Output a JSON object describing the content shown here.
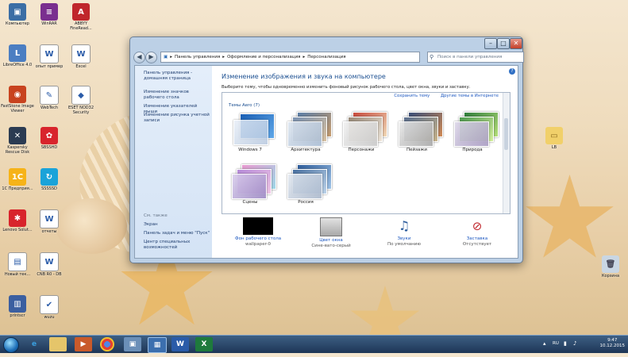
{
  "desktop": {
    "icons": [
      {
        "label": "Компьютер",
        "color": "#3b6ea5",
        "glyph": "▣",
        "icon": "computer-icon"
      },
      {
        "label": "WinRAR",
        "color": "#7a2f8f",
        "glyph": "≡",
        "icon": "winrar-icon"
      },
      {
        "label": "ABBYY FineRead...",
        "color": "#c0262c",
        "glyph": "A",
        "icon": "abbyy-icon"
      },
      {
        "label": "LibreOffice 4.0",
        "color": "#4b7ec2",
        "glyph": "L",
        "icon": "libreoffice-icon"
      },
      {
        "label": "опыт пример",
        "color": "#ffffff",
        "glyph": "W",
        "icon": "word-document-icon"
      },
      {
        "label": "Excel",
        "color": "#ffffff",
        "glyph": "W",
        "icon": "word-document-icon"
      },
      {
        "label": "FastStone Image Viewer",
        "color": "#c8431f",
        "glyph": "◉",
        "icon": "faststone-icon"
      },
      {
        "label": "WebTech",
        "color": "#ffffff",
        "glyph": "✎",
        "icon": "webtech-icon"
      },
      {
        "label": "ESET NOD32 Security",
        "color": "#ffffff",
        "glyph": "◆",
        "icon": "eset-icon"
      },
      {
        "label": "Kaspersky Rescue Disk",
        "color": "#2b3b52",
        "glyph": "✕",
        "icon": "rescue-disk-icon"
      },
      {
        "label": "SBSSHD",
        "color": "#d8242c",
        "glyph": "✿",
        "icon": "sbsshd-icon"
      },
      {
        "label": "1С Предприя...",
        "color": "#f6b318",
        "glyph": "1С",
        "icon": "1c-icon"
      },
      {
        "label": "SSSSSD",
        "color": "#1aa3d9",
        "glyph": "↻",
        "icon": "sync-icon"
      },
      {
        "label": "Lenovo Solut...",
        "color": "#d8242c",
        "glyph": "✱",
        "icon": "lenovo-icon"
      },
      {
        "label": "отчеты",
        "color": "#ffffff",
        "glyph": "W",
        "icon": "word-document-icon"
      },
      {
        "label": "Новый тек...",
        "color": "#ffffff",
        "glyph": "▤",
        "icon": "pdf-document-icon"
      },
      {
        "label": "CNB R0 - DB",
        "color": "#ffffff",
        "glyph": "W",
        "icon": "word-document-icon"
      },
      {
        "label": "printscr",
        "color": "#3b5fa0",
        "glyph": "▥",
        "icon": "printscreen-icon"
      },
      {
        "label": "wuzu",
        "color": "#ffffff",
        "glyph": "✔",
        "icon": "checklist-icon"
      }
    ],
    "folder_label": "LB",
    "recycle_label": "Корзина"
  },
  "window": {
    "buttons": {
      "minimize": "–",
      "maximize": "□",
      "close": "✕"
    },
    "nav": {
      "back": "◀",
      "forward": "▶"
    },
    "breadcrumb": [
      "Панель управления",
      "Оформление и персонализация",
      "Персонализация"
    ],
    "search_placeholder": "Поиск в панели управления",
    "left_links": [
      "Панель управления - домашняя страница",
      "Изменение значков рабочего стола",
      "Изменение указателей мыши",
      "Изменение рисунка учетной записи"
    ],
    "see_also_title": "См. также",
    "see_also_links": [
      "Экран",
      "Панель задач и меню \"Пуск\"",
      "Центр специальных возможностей"
    ],
    "help": "?",
    "page_title": "Изменение изображения и звука на компьютере",
    "page_desc": "Выберите тему, чтобы одновременно изменить фоновый рисунок рабочего стола, цвет окна, звуки и заставку.",
    "theme_links": [
      "Сохранить тему",
      "Другие темы в Интернете"
    ],
    "group_title": "Темы Aero (7)",
    "themes": [
      "Windows 7",
      "Архитектура",
      "Персонажи",
      "Пейзажи",
      "Природа",
      "Сцены",
      "Россия"
    ],
    "settings": [
      {
        "title": "Фон рабочего стола",
        "value": "wallpaper-0"
      },
      {
        "title": "Цвет окна",
        "value": "Сине-вато-серый"
      },
      {
        "title": "Звуки",
        "value": "По умолчанию"
      },
      {
        "title": "Заставка",
        "value": "Отсутствует"
      }
    ]
  },
  "taskbar": {
    "time": "9:47",
    "date": "10.12.2015",
    "lang": "RU"
  },
  "colors": {
    "link": "#1a56c0",
    "title": "#1b4f91",
    "taskbar": "#1e3656"
  }
}
